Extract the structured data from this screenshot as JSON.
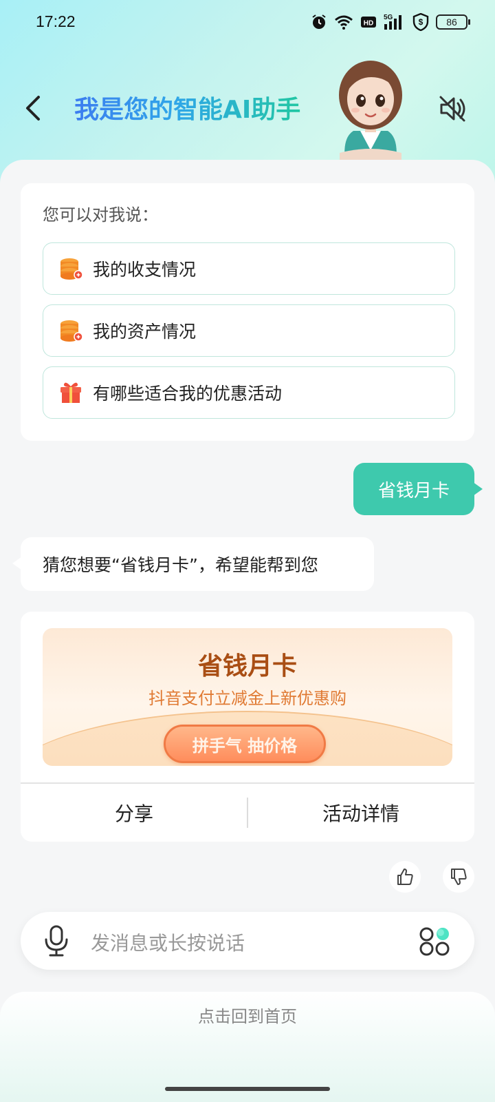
{
  "status_bar": {
    "time": "17:22",
    "battery": "86",
    "icons": [
      "alarm-icon",
      "wifi-icon",
      "hd-icon",
      "5g-signal-icon",
      "security-shield-icon",
      "battery-icon"
    ]
  },
  "header": {
    "title": "我是您的智能AI助手",
    "back_icon": "chevron-left-icon",
    "avatar_icon": "assistant-avatar",
    "mute_icon": "speaker-muted-icon"
  },
  "suggestions": {
    "hint": "您可以对我说：",
    "items": [
      {
        "label": "我的收支情况",
        "icon": "coins-stack-icon"
      },
      {
        "label": "我的资产情况",
        "icon": "coins-stack-icon"
      },
      {
        "label": "有哪些适合我的优惠活动",
        "icon": "gift-icon"
      }
    ]
  },
  "chat": {
    "user_message": "省钱月卡",
    "bot_message": "猜您想要“省钱月卡”，希望能帮到您"
  },
  "promo": {
    "title": "省钱月卡",
    "subtitle": "抖音支付立减金上新优惠购",
    "button": "拼手气 抽价格",
    "actions": [
      "分享",
      "活动详情"
    ]
  },
  "feedback": {
    "like_icon": "thumbs-up-icon",
    "dislike_icon": "thumbs-down-icon"
  },
  "input": {
    "placeholder": "发消息或长按说话",
    "mic_icon": "microphone-icon",
    "apps_icon": "apps-grid-icon"
  },
  "footer": {
    "home_link": "点击回到首页"
  },
  "colors": {
    "accent": "#3ec9ad",
    "title_gradient_start": "#3c7df0",
    "title_gradient_end": "#22c7a3",
    "promo_title": "#a94e14",
    "promo_subtitle": "#e07a33",
    "promo_button": "#ff8d5c"
  }
}
